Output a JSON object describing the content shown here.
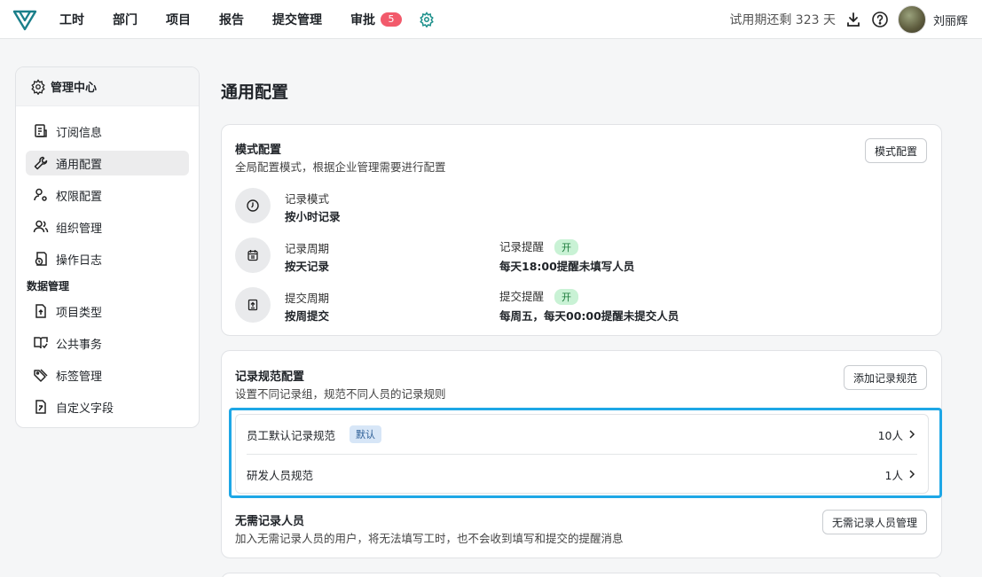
{
  "colors": {
    "accent_highlight": "#1ea7e6",
    "badge_red": "#f25a6b",
    "on_tag_bg": "#c9f2d5",
    "logo_teal": "#1a7f8a"
  },
  "nav": {
    "items": [
      "工时",
      "部门",
      "项目",
      "报告",
      "提交管理",
      "审批"
    ],
    "approval_badge": "5",
    "settings_icon": "gear-icon"
  },
  "topright": {
    "trial_text": "试用期还剩 323 天",
    "download_icon": "download-icon",
    "help_icon": "help-icon",
    "username": "刘丽辉"
  },
  "sidebar": {
    "title": "管理中心",
    "items": [
      {
        "label": "订阅信息",
        "icon": "subscription-icon"
      },
      {
        "label": "通用配置",
        "icon": "wrench-icon",
        "active": true
      },
      {
        "label": "权限配置",
        "icon": "user-permission-icon"
      },
      {
        "label": "组织管理",
        "icon": "users-icon"
      },
      {
        "label": "操作日志",
        "icon": "log-icon"
      }
    ],
    "section": "数据管理",
    "data_items": [
      {
        "label": "项目类型",
        "icon": "project-type-icon"
      },
      {
        "label": "公共事务",
        "icon": "book-icon"
      },
      {
        "label": "标签管理",
        "icon": "tag-icon"
      },
      {
        "label": "自定义字段",
        "icon": "custom-field-icon"
      }
    ]
  },
  "main": {
    "page_title": "通用配置",
    "mode_card": {
      "title": "模式配置",
      "desc": "全局配置模式，根据企业管理需要进行配置",
      "button": "模式配置",
      "record_mode_label": "记录模式",
      "record_mode_value": "按小时记录",
      "record_period_label": "记录周期",
      "record_period_value": "按天记录",
      "record_reminder_label": "记录提醒",
      "record_reminder_tag": "开",
      "record_reminder_value": "每天18:00提醒未填写人员",
      "submit_period_label": "提交周期",
      "submit_period_value": "按周提交",
      "submit_reminder_label": "提交提醒",
      "submit_reminder_tag": "开",
      "submit_reminder_value": "每周五，每天00:00提醒未提交人员"
    },
    "rule_card": {
      "title": "记录规范配置",
      "desc": "设置不同记录组，规范不同人员的记录规则",
      "button": "添加记录规范",
      "rules": [
        {
          "name": "员工默认记录规范",
          "tag": "默认",
          "count": "10人"
        },
        {
          "name": "研发人员规范",
          "count": "1人"
        }
      ],
      "exempt_title": "无需记录人员",
      "exempt_desc": "加入无需记录人员的用户，将无法填写工时，也不会收到填写和提交的提醒消息",
      "exempt_button": "无需记录人员管理"
    }
  }
}
